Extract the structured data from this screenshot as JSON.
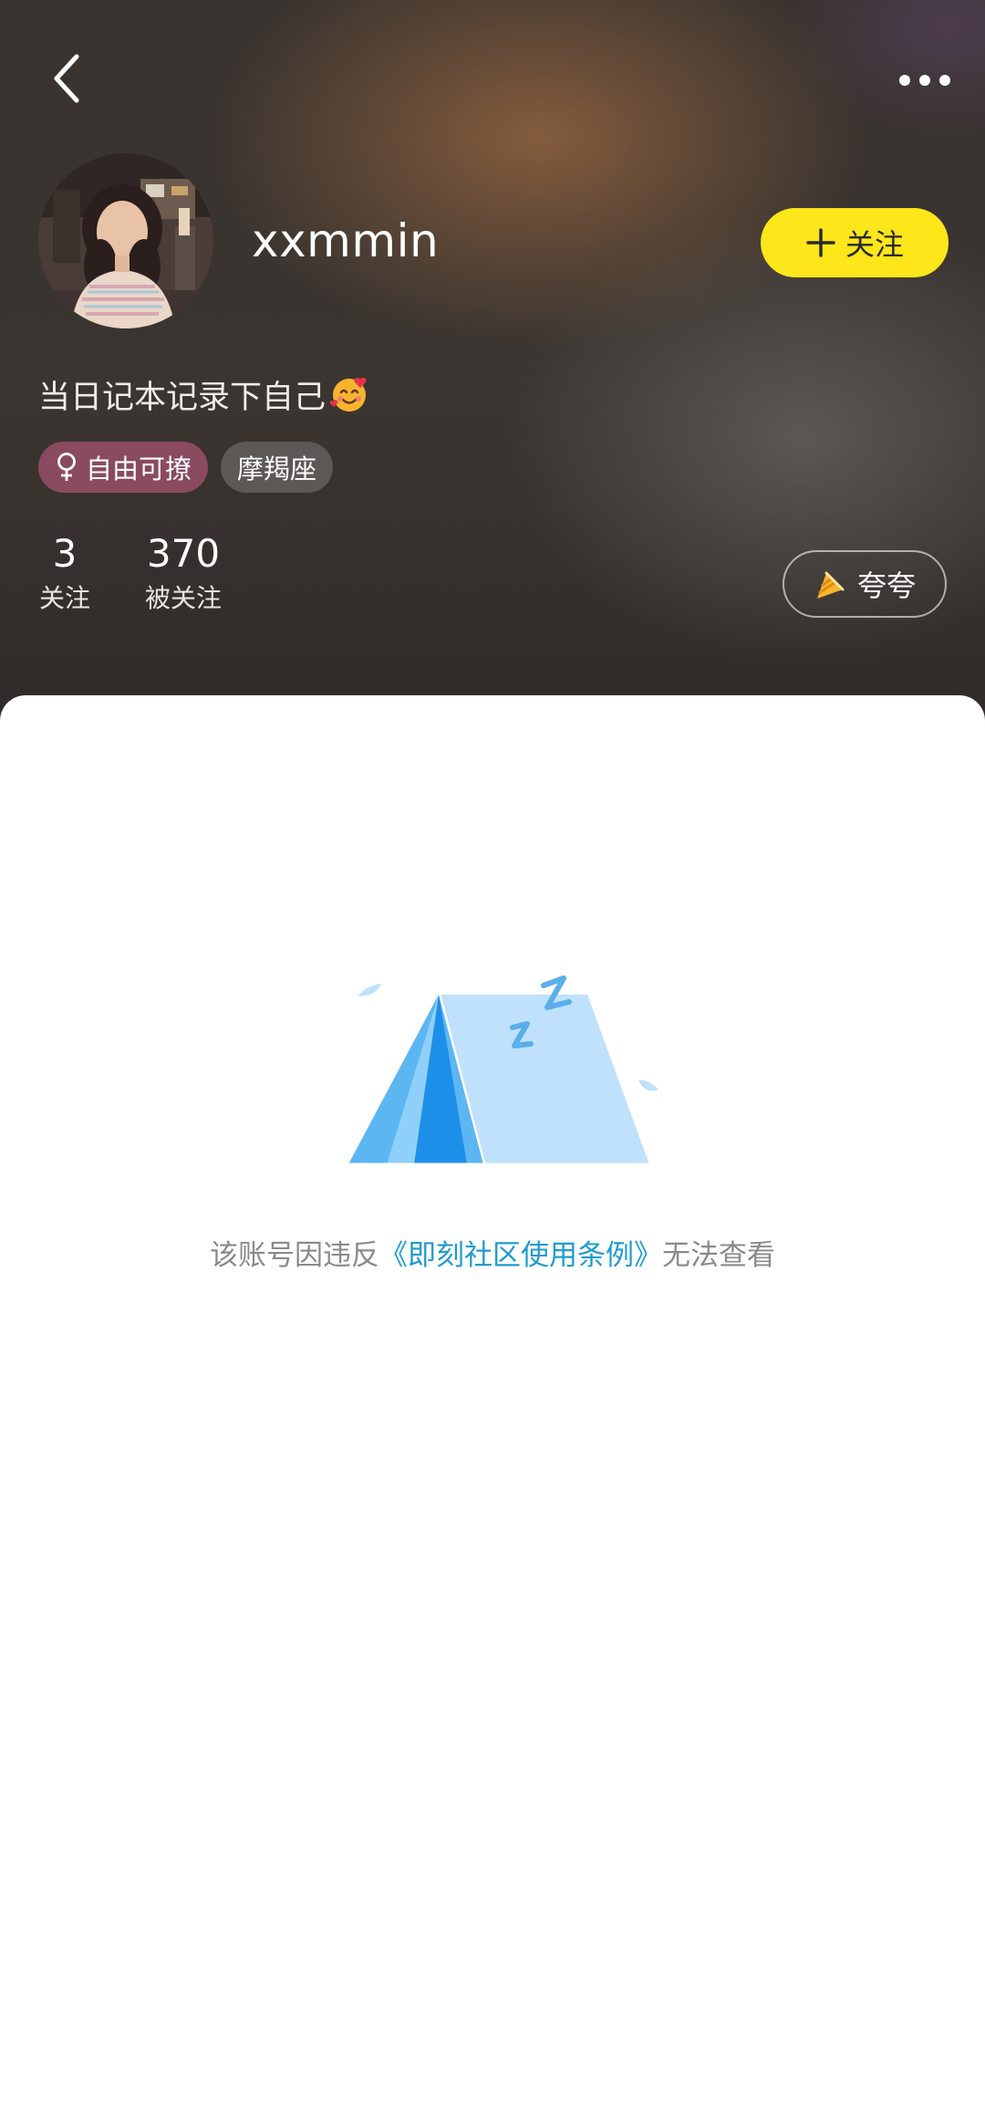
{
  "header": {
    "back_icon": "chevron-left-icon",
    "more_icon": "more-horizontal-icon"
  },
  "profile": {
    "username": "xxmmin",
    "follow_label": "关注",
    "bio": "当日记本记录下自己",
    "bio_emoji_icon": "smiling-face-with-hearts-icon",
    "tags": {
      "gender_label": "自由可撩",
      "gender_icon": "female-symbol-icon",
      "zodiac_label": "摩羯座"
    },
    "stats": {
      "following_count": "3",
      "following_label": "关注",
      "followers_count": "370",
      "followers_label": "被关注"
    },
    "praise_label": "夸夸",
    "praise_icon": "party-cone-icon"
  },
  "content": {
    "illustration_icon": "sleeping-tent-icon",
    "notice_prefix": "该账号因违反",
    "notice_link": "《即刻社区使用条例》",
    "notice_suffix": "无法查看"
  },
  "colors": {
    "accent_yellow": "#fde619",
    "link_blue": "#1f9bd0",
    "gender_tag": "#8a4a5f",
    "zodiac_tag": "#5c5856",
    "header_dark": "#39332f"
  }
}
